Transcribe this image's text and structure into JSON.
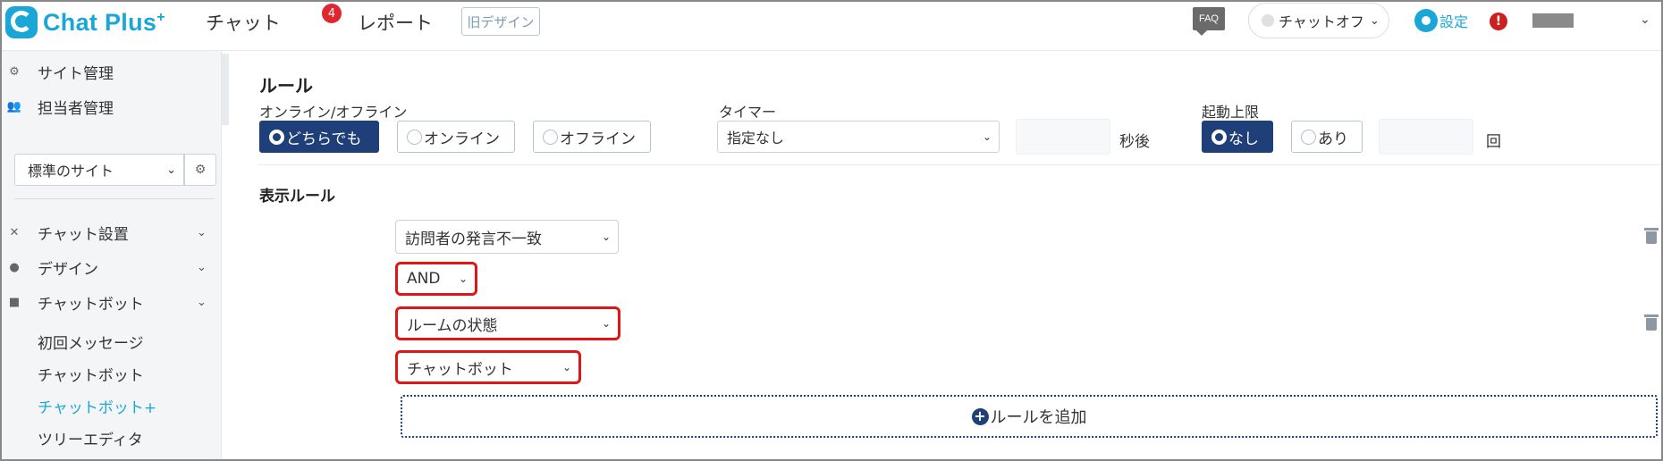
{
  "header": {
    "logo_text": "Chat Plus",
    "logo_sup": "+",
    "nav": [
      {
        "label": "チャット",
        "badge": "4"
      },
      {
        "label": "レポート"
      }
    ],
    "old_design": "旧デザイン",
    "faq": "FAQ",
    "chat_status": "チャットオフ",
    "settings": "設定",
    "alert": "!"
  },
  "sidebar": {
    "top_items": [
      {
        "label": "サイト管理",
        "icon": "gear-small-icon"
      },
      {
        "label": "担当者管理",
        "icon": "users-icon"
      }
    ],
    "site_select": "標準のサイト",
    "sections": [
      {
        "label": "チャット設置",
        "icon": "tools-icon"
      },
      {
        "label": "デザイン",
        "icon": "palette-icon"
      },
      {
        "label": "チャットボット",
        "icon": "chat-icon"
      }
    ],
    "sub_items": [
      "初回メッセージ",
      "チャットボット",
      "チャットボット+",
      "ツリーエディタ"
    ],
    "active_sub": "チャットボット+"
  },
  "main": {
    "rule_title": "ルール",
    "online_label": "オンライン/オフライン",
    "online_options": [
      "どちらでも",
      "オンライン",
      "オフライン"
    ],
    "online_selected": "どちらでも",
    "timer_label": "タイマー",
    "timer_value": "指定なし",
    "timer_unit": "秒後",
    "limit_label": "起動上限",
    "limit_options": [
      "なし",
      "あり"
    ],
    "limit_selected": "なし",
    "limit_unit": "回",
    "display_rule_title": "表示ルール",
    "rule1": "訪問者の発言不一致",
    "operator": "AND",
    "rule2": "ルームの状態",
    "rule2_value": "チャットボット",
    "add_rule": "ルールを追加"
  },
  "colors": {
    "accent": "#1aa7d8",
    "selected": "#1e3f77",
    "highlight": "#e01616",
    "badge": "#e0262e"
  }
}
